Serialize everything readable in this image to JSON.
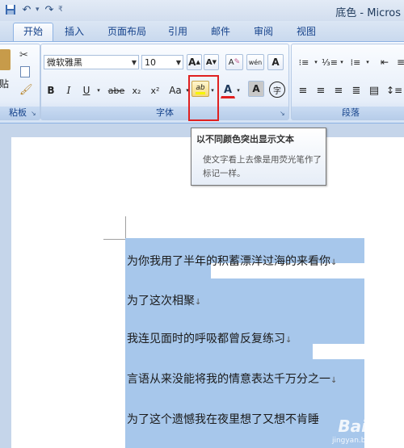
{
  "title_bar": {
    "doc_title": "底色 - Micros"
  },
  "quick_access": {
    "icons": [
      "save-icon",
      "undo-icon",
      "redo-icon",
      "customize-icon"
    ]
  },
  "tabs": [
    {
      "label": "开始",
      "active": true
    },
    {
      "label": "插入"
    },
    {
      "label": "页面布局"
    },
    {
      "label": "引用"
    },
    {
      "label": "邮件"
    },
    {
      "label": "审阅"
    },
    {
      "label": "视图"
    }
  ],
  "clipboard": {
    "paste_label": "贴",
    "group_label": "粘板"
  },
  "font_group": {
    "font_name": "微软雅黑",
    "font_size": "10",
    "group_label": "字体",
    "grow": "A",
    "shrink": "A",
    "clear": "A",
    "phonetic": "wén",
    "border_char": "A",
    "bold": "B",
    "italic": "I",
    "underline": "U",
    "strike": "abe",
    "sub": "x₂",
    "sup": "x²",
    "case": "Aa",
    "highlight": "ab",
    "font_color": "A",
    "shading": "A",
    "circle": "字"
  },
  "paragraph_group": {
    "group_label": "段落"
  },
  "tooltip": {
    "title": "以不同颜色突出显示文本",
    "body": "使文字看上去像是用荧光笔作了标记一样。"
  },
  "document": {
    "lines": [
      "为你我用了半年的积蓄漂洋过海的来看你",
      "为了这次相聚",
      "我连见面时的呼吸都曾反复练习",
      "言语从来没能将我的情意表达千万分之一",
      "为了这个遗憾我在夜里想了又想不肯睡"
    ],
    "paragraph_mark": "↓"
  },
  "watermark": {
    "brand": "Bai经验",
    "url": "jingyan.baidu.com"
  },
  "colors": {
    "selection": "#a7c7eb",
    "ribbon": "#dbe6f4",
    "red_highlight_box": "#e02020",
    "highlight_yellow": "#f5f500"
  }
}
